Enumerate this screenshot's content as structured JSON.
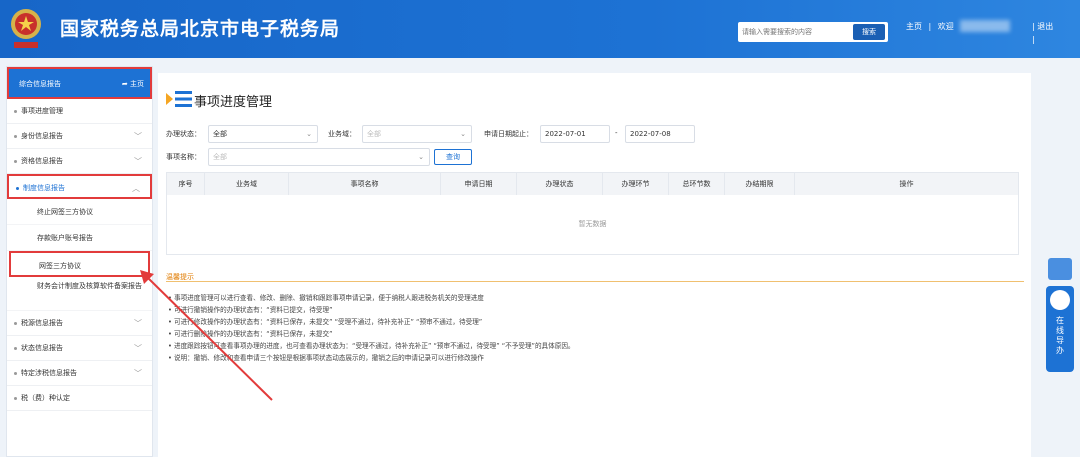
{
  "header": {
    "title": "国家税务总局北京市电子税务局",
    "search_placeholder": "请输入需要搜索的内容",
    "search_button": "搜索",
    "home_link": "主页",
    "welcome": "欢迎",
    "logout": "退出"
  },
  "sidebar": {
    "head_label": "综合信息报告",
    "head_home": "主页",
    "items": [
      {
        "label": "事项进度管理"
      },
      {
        "label": "身份信息报告"
      },
      {
        "label": "资格信息报告"
      },
      {
        "label": "制度信息报告"
      },
      {
        "label": "税源信息报告"
      },
      {
        "label": "状态信息报告"
      },
      {
        "label": "特定涉税信息报告"
      },
      {
        "label": "税（费）种认定"
      }
    ],
    "sub_items": [
      {
        "label": "终止网签三方协议"
      },
      {
        "label": "存款账户账号报告"
      },
      {
        "label": "网签三方协议"
      },
      {
        "label": "财务会计制度及核算软件备案报告"
      }
    ]
  },
  "main": {
    "title": "事项进度管理",
    "filters": {
      "status_label": "办理状态：",
      "status_value": "全部",
      "domain_label": "业务域：",
      "domain_value": "全部",
      "date_label": "申请日期起止：",
      "date_from": "2022-07-01",
      "date_sep": "-",
      "date_to": "2022-07-08",
      "name_label": "事项名称：",
      "name_value": "全部",
      "query_button": "查询"
    },
    "table": {
      "columns": [
        "序号",
        "业务域",
        "事项名称",
        "申请日期",
        "办理状态",
        "办理环节",
        "总环节数",
        "办结期限",
        "操作"
      ],
      "empty_text": "暂无数据"
    },
    "tips": {
      "title": "温馨提示",
      "lines": [
        "事项进度管理可以进行查看、修改、删除、撤销和跟踪事项申请记录，便于纳税人跟进税务机关的受理进度",
        "可进行撤销操作的办理状态有：“资料已提交，待受理”",
        "可进行修改操作的办理状态有：“资料已保存，未提交” “受理不通过，待补充补正” “预审不通过，待受理”",
        "可进行删除操作的办理状态有：“资料已保存，未提交”",
        "进度跟踪按钮可查看事项办理的进度，也可查看办理状态为：“受理不通过，待补充补正” “预审不通过，待受理” “不予受理”的具体原因。",
        "说明：撤销、修改和查看申请三个按钮是根据事项状态动态展示的，撤销之后的申请记录可以进行修改操作"
      ]
    }
  },
  "widget": {
    "label": "在线导办"
  },
  "colors": {
    "brand": "#1d72d4",
    "highlight": "#e23b3b",
    "tip": "#e07b00"
  }
}
